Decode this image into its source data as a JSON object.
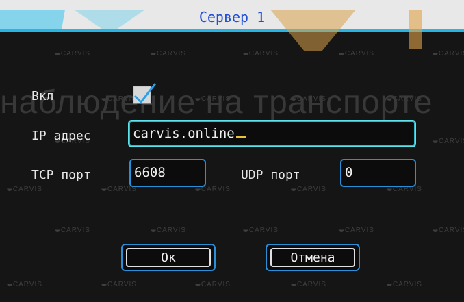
{
  "dialog": {
    "title": "Сервер 1"
  },
  "watermark": {
    "brand": "CARVIS",
    "caption": "наблюдение на транспорте"
  },
  "form": {
    "enable": {
      "label": "Вкл",
      "checked": true
    },
    "ip": {
      "label": "IP адрес",
      "value": "carvis.online"
    },
    "tcp": {
      "label": "TCP порт",
      "value": "6608"
    },
    "udp": {
      "label": "UDP порт",
      "value": "0"
    }
  },
  "buttons": {
    "ok": "Ок",
    "cancel": "Отмена"
  },
  "colors": {
    "title_text": "#1f4fd6",
    "accent": "#25b6e6",
    "field_border": "#2a8ed8",
    "focus_border": "#5be3ee",
    "check": "#2aa0e8"
  }
}
